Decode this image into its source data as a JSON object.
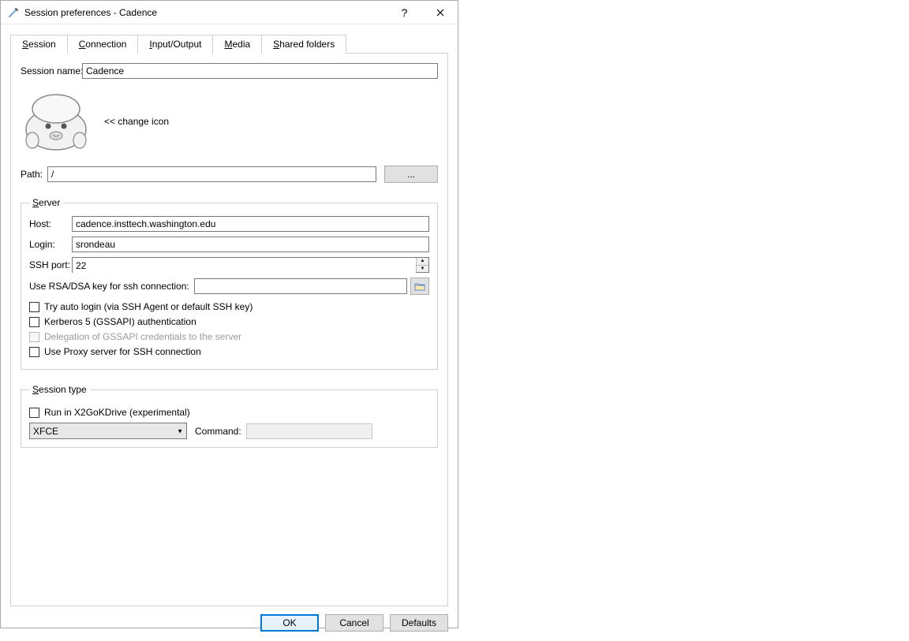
{
  "window": {
    "title": "Session preferences - Cadence"
  },
  "tabs": {
    "session": "Session",
    "connection": "Connection",
    "io": "Input/Output",
    "media": "Media",
    "shared": "Shared folders"
  },
  "labels": {
    "session_name": "Session name:",
    "change_icon": "<< change icon",
    "path": "Path:",
    "browse": "...",
    "server_legend": "Server",
    "host": "Host:",
    "login": "Login:",
    "ssh_port": "SSH port:",
    "rsa": "Use RSA/DSA key for ssh connection:",
    "auto_login": "Try auto login (via SSH Agent or default SSH key)",
    "kerberos": "Kerberos 5 (GSSAPI) authentication",
    "delegation": "Delegation of GSSAPI credentials to the server",
    "proxy": "Use Proxy server for SSH connection",
    "session_type_legend": "Session type",
    "kdrive": "Run in X2GoKDrive (experimental)",
    "command": "Command:"
  },
  "values": {
    "session_name": "Cadence",
    "path": "/",
    "host": "cadence.insttech.washington.edu",
    "login": "srondeau",
    "ssh_port": "22",
    "rsa_key": "",
    "session_type": "XFCE",
    "command": ""
  },
  "buttons": {
    "ok": "OK",
    "cancel": "Cancel",
    "defaults": "Defaults"
  }
}
